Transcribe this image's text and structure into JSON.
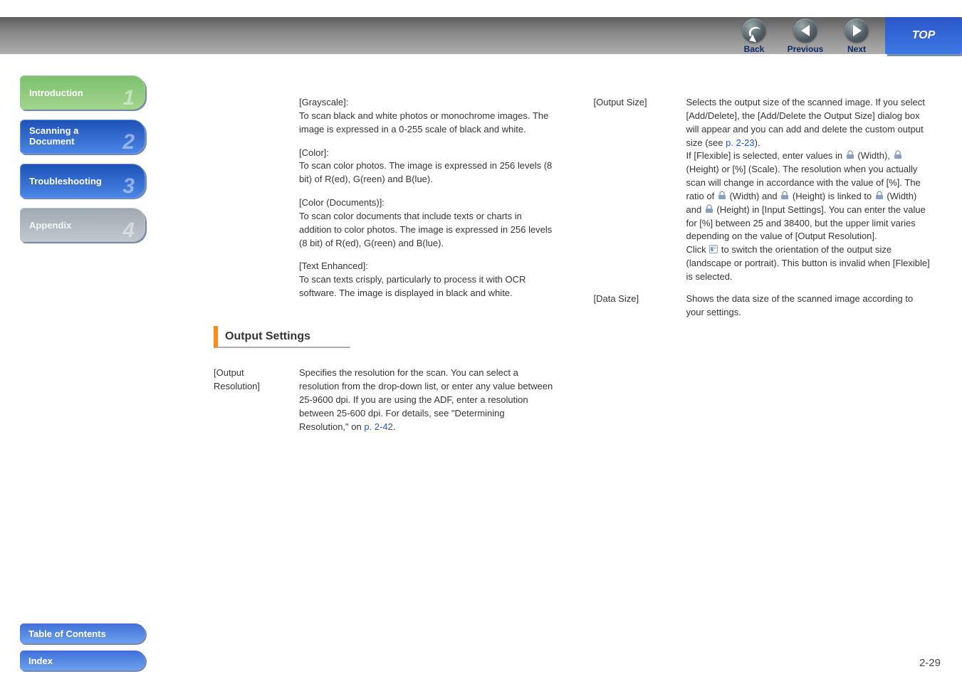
{
  "topnav": {
    "back": "Back",
    "previous": "Previous",
    "next": "Next",
    "top": "TOP"
  },
  "sidebar": {
    "items": [
      {
        "label": "Introduction",
        "num": "1"
      },
      {
        "label_line1": "Scanning a",
        "label_line2": "Document",
        "num": "2"
      },
      {
        "label": "Troubleshooting",
        "num": "3"
      },
      {
        "label": "Appendix",
        "num": "4"
      }
    ],
    "toc": "Table of Contents",
    "index": "Index"
  },
  "left_column": {
    "grayscale_term": "[Grayscale]:",
    "grayscale_body": "To scan black and white photos or monochrome images. The image is expressed in a 0-255 scale of black and white.",
    "color_term": "[Color]:",
    "color_body": "To scan color photos. The image is expressed in 256 levels (8 bit) of R(ed), G(reen) and B(lue).",
    "colordoc_term": "[Color (Documents)]:",
    "colordoc_body": "To scan color documents that include texts or charts in addition to color photos. The image is expressed in 256 levels (8 bit) of R(ed), G(reen) and B(lue).",
    "textenh_term": "[Text Enhanced]:",
    "textenh_body": "To scan texts crisply, particularly to process it with OCR software. The image is displayed in black and white.",
    "section_heading": "Output Settings",
    "outres_label": "[Output Resolution]",
    "outres_body_a": "Specifies the resolution for the scan. You can select a resolution from the drop-down list, or enter any value between 25-9600 dpi. If you are using the ADF, enter a resolution between 25-600 dpi. For details, see \"Determining Resolution,\" on ",
    "outres_body_link": "p. 2-42",
    "outres_body_b": "."
  },
  "right_column": {
    "outsize_label": "[Output Size]",
    "data_size_label": "[Data Size]",
    "outsize_a": "Selects the output size of the scanned image. If you select [Add/Delete], the [Add/Delete the Output Size] dialog box will appear and you can add and delete the custom output size (see ",
    "outsize_link1": "p. 2-23",
    "outsize_b": ").",
    "outsize_c": "If [Flexible] is selected, enter values in ",
    "outsize_d": " (Width), ",
    "outsize_e": " (Height) or [%] (Scale). The resolution when you actually scan will change in accordance with the value of [%]. The ratio of ",
    "outsize_f": " (Width) and ",
    "outsize_g": " (Height) is linked to ",
    "outsize_h": " (Width) and ",
    "outsize_i": " (Height) in [Input Settings]. You can enter the value for [%] between 25 and 38400, but the upper limit varies depending on the value of [Output Resolution].",
    "outsize_j": "Click ",
    "outsize_k": " to switch the orientation of the output size (landscape or portrait). This button is invalid when [Flexible] is selected.",
    "datasize_body": "Shows the data size of the scanned image according to your settings."
  },
  "page_number": "2-29"
}
